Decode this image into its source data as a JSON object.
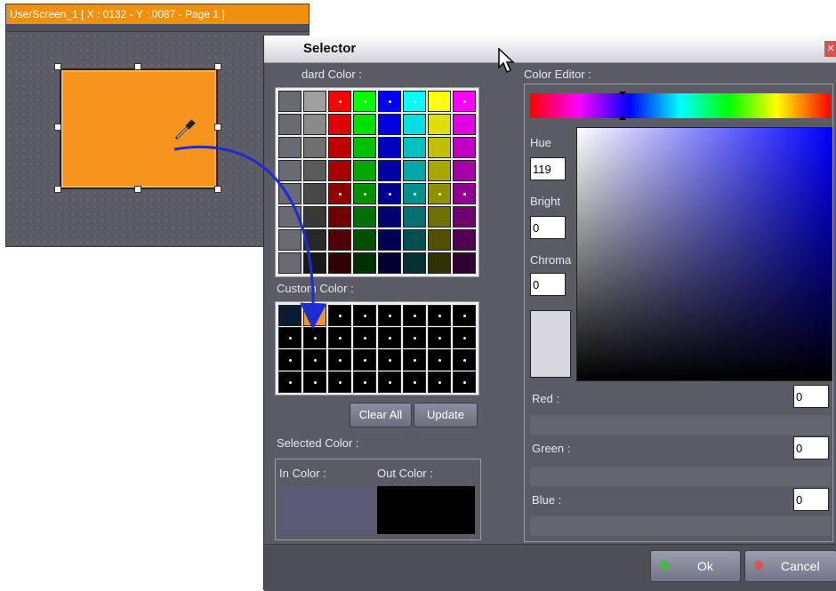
{
  "userscreen": {
    "title": "UserScreen_1 [ X : 0132 - Y : 0087 - Page 1 ]",
    "shape_fill": "#f7941d"
  },
  "dialog": {
    "title": "Selector",
    "close_icon": "close-icon",
    "standard_color_label": "dard Color :",
    "custom_color_label": "Custom Color :",
    "color_editor_label": "Color Editor :",
    "clear_all": "Clear All",
    "update": "Update",
    "selected_color_label": "Selected Color :",
    "in_color_label": "In Color :",
    "out_color_label": "Out Color :",
    "in_color": "#5b5b73",
    "out_color": "#000000",
    "hue_label": "Hue",
    "hue_value": "119",
    "bright_label": "Bright",
    "bright_value": "0",
    "chroma_label": "Chroma",
    "chroma_value": "0",
    "red_label": "Red :",
    "red_value": "0",
    "green_label": "Green :",
    "green_value": "0",
    "blue_label": "Blue :",
    "blue_value": "0",
    "ok": "Ok",
    "cancel": "Cancel"
  },
  "standard_colors": [
    [
      "#a0a0a0",
      "#ff0000",
      "#00ff00",
      "#0000ff",
      "#00ffff",
      "#ffff00",
      "#ff00ff"
    ],
    [
      "#8a8a8a",
      "#e00000",
      "#00e000",
      "#0000e0",
      "#00e0e0",
      "#e0e000",
      "#e000e0"
    ],
    [
      "#707070",
      "#c00000",
      "#00c000",
      "#0000c0",
      "#00c0c0",
      "#c0c000",
      "#c000c0"
    ],
    [
      "#5a5a5a",
      "#a80000",
      "#00a800",
      "#0000a8",
      "#00a8a8",
      "#a8a800",
      "#a800a8"
    ],
    [
      "#484848",
      "#900000",
      "#009000",
      "#000090",
      "#009090",
      "#909000",
      "#900090"
    ],
    [
      "#383838",
      "#700000",
      "#007000",
      "#000070",
      "#007070",
      "#707000",
      "#700070"
    ],
    [
      "#282828",
      "#500000",
      "#005000",
      "#000050",
      "#005050",
      "#505000",
      "#500050"
    ],
    [
      "#181818",
      "#300000",
      "#003000",
      "#000030",
      "#003030",
      "#303000",
      "#300030"
    ]
  ],
  "custom_colors": [
    "#0a1a33",
    "#f7941d",
    "#000000",
    "#000000",
    "#000000",
    "#000000",
    "#000000",
    "#000000"
  ],
  "cursor_icon": "mouse-pointer-icon",
  "dropper_icon": "eyedropper-icon"
}
